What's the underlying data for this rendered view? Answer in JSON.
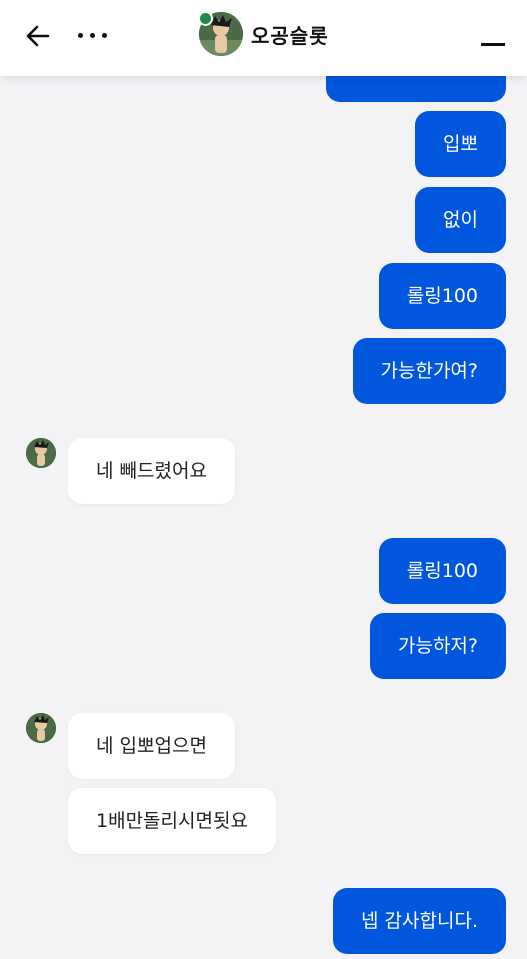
{
  "header": {
    "title": "오공슬롯",
    "back_icon": "arrow-left-icon",
    "more_icon": "more-dots-icon",
    "minimize_icon": "minimize-icon",
    "online_color": "#1e8a48"
  },
  "colors": {
    "outgoing": "#0056dd",
    "incoming": "#ffffff",
    "background": "#f3f2f5"
  },
  "messages": [
    {
      "side": "out",
      "text": "입뽀"
    },
    {
      "side": "out",
      "text": "없이"
    },
    {
      "side": "out",
      "text": "롤링100"
    },
    {
      "side": "out",
      "text": "가능한가여?"
    },
    {
      "side": "in",
      "text": "네 빼드렸어요"
    },
    {
      "side": "out",
      "text": "롤링100"
    },
    {
      "side": "out",
      "text": "가능하저?"
    },
    {
      "side": "in",
      "text": "네 입뽀업으면"
    },
    {
      "side": "in",
      "text": "1배만돌리시면됫요"
    },
    {
      "side": "out",
      "text": "넵 감사합니다."
    }
  ]
}
